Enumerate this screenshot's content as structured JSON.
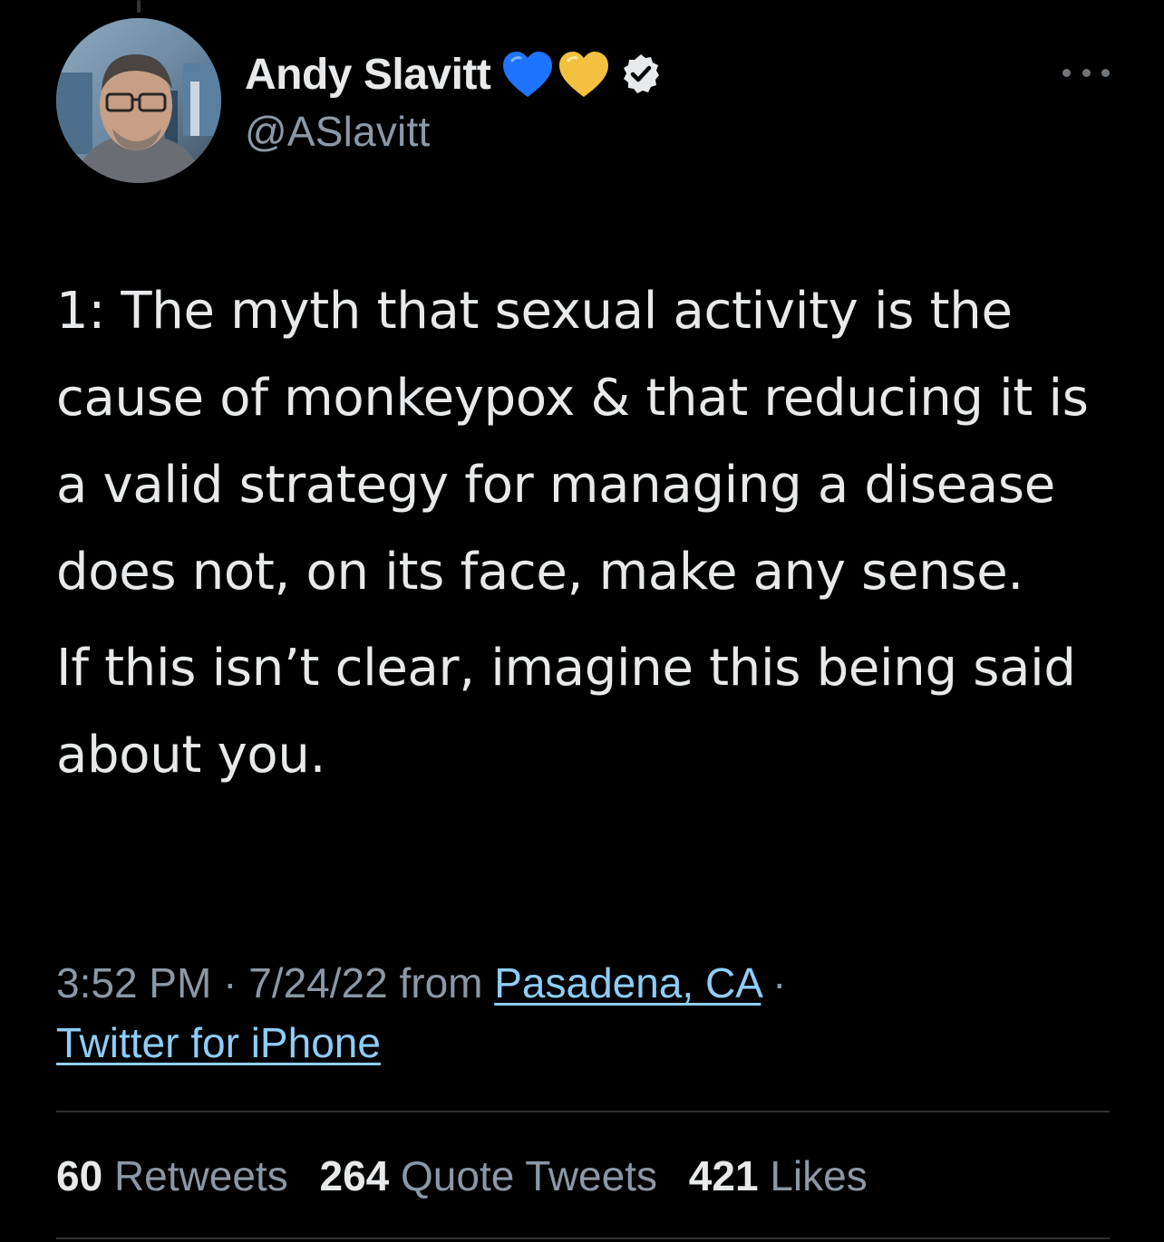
{
  "tweet": {
    "author": {
      "display_name": "Andy Slavitt",
      "handle": "@ASlavitt",
      "emojis": [
        "blue-heart",
        "yellow-heart"
      ],
      "verified": true
    },
    "body": [
      "1: The myth that sexual activity is the cause of monkeypox & that reducing it is a valid strategy for managing a disease does not, on its face, make any sense.",
      "If this isn’t clear, imagine this being said about you."
    ],
    "meta": {
      "time": "3:52 PM",
      "date": "7/24/22",
      "from_label": "from",
      "location": "Pasadena, CA",
      "source": "Twitter for iPhone",
      "separator": "·"
    },
    "stats": {
      "retweets_count": "60",
      "retweets_label": "Retweets",
      "quotes_count": "264",
      "quotes_label": "Quote Tweets",
      "likes_count": "421",
      "likes_label": "Likes"
    }
  },
  "colors": {
    "background": "#000000",
    "text_primary": "#e7e9ea",
    "text_secondary": "#8b98a5",
    "link": "#8ecdf8",
    "divider": "#2f3336"
  }
}
